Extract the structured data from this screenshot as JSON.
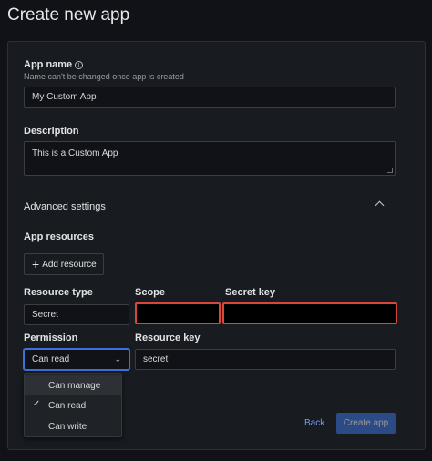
{
  "page": {
    "title": "Create new app"
  },
  "app_name": {
    "label": "App name",
    "description": "Name can't be changed once app is created",
    "value": "My Custom App"
  },
  "description": {
    "label": "Description",
    "value": "This is a Custom App"
  },
  "advanced": {
    "label": "Advanced settings",
    "icon": "chevron-up-icon"
  },
  "resources": {
    "label": "App resources",
    "add_button": "Add resource",
    "columns": {
      "resource_type": "Resource type",
      "scope": "Scope",
      "secret_key": "Secret key",
      "permission": "Permission",
      "resource_key": "Resource key"
    },
    "resource_type_value": "Secret",
    "permission_value": "Can read",
    "resource_key_value": "secret",
    "redaction_color": "#d9463b"
  },
  "permission_menu": {
    "options": [
      "Can manage",
      "Can read",
      "Can write"
    ],
    "selected": "Can read",
    "highlighted": "Can manage"
  },
  "footer": {
    "back": "Back",
    "create": "Create app",
    "primary_color": "#3d71d9",
    "link_color": "#6e9fff"
  }
}
